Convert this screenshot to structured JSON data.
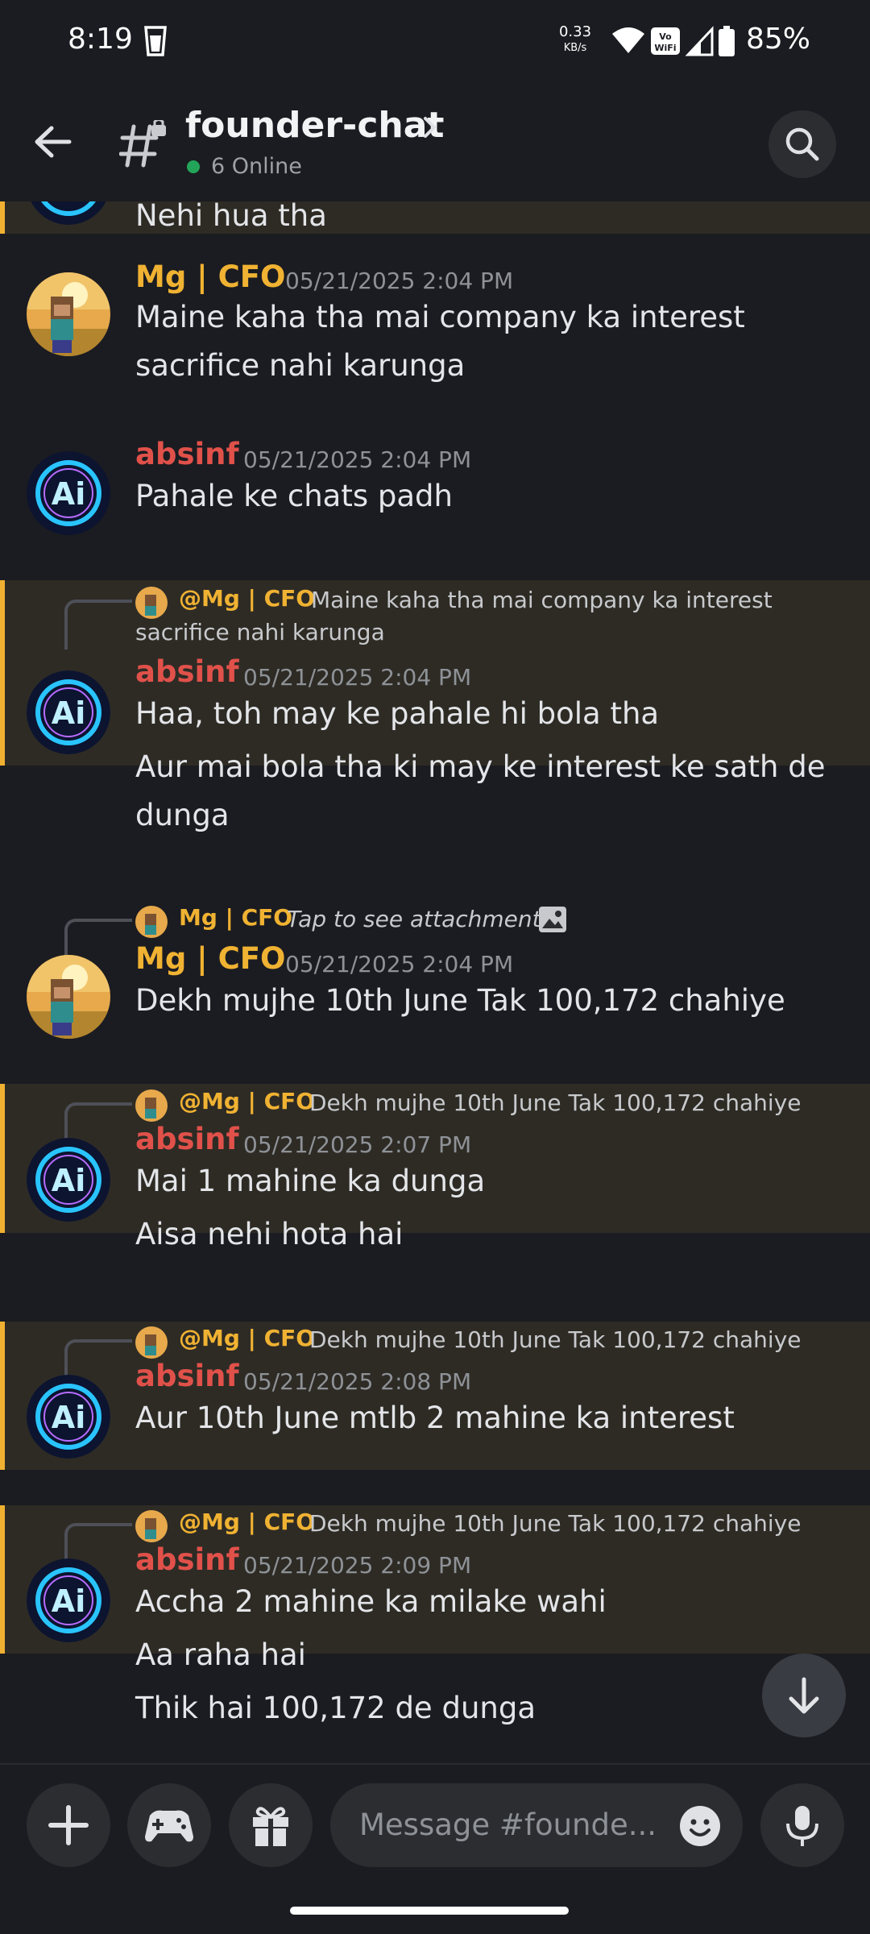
{
  "status_bar": {
    "time": "8:19",
    "net_speed": "0.33",
    "net_unit": "KB/s",
    "battery": "85%",
    "icons": [
      "trash-icon",
      "wifi-icon",
      "vowifi-icon",
      "signal-icon",
      "battery-icon"
    ]
  },
  "header": {
    "channel_name": "founder-chat",
    "online": "6 Online",
    "online_color": "#23a559"
  },
  "colors": {
    "cfo_name": "#f0b232",
    "absinf_name": "#e0514a",
    "highlight_bg": "#2e2b25",
    "highlight_bar": "#f0b132"
  },
  "messages": {
    "m0_text": "Nehi hua tha",
    "m1": {
      "author": "Mg | CFO",
      "time": "05/21/2025 2:04 PM",
      "line1": "Maine kaha tha mai company ka interest",
      "line2": "sacrifice nahi karunga"
    },
    "m2": {
      "author": "absinf",
      "time": "05/21/2025 2:04 PM",
      "text": "Pahale ke chats padh"
    },
    "m3": {
      "reply_name": "@Mg | CFO",
      "reply_line1": "Maine kaha tha mai company ka interest",
      "reply_line2": "sacrifice nahi karunga",
      "author": "absinf",
      "time": "05/21/2025 2:04 PM",
      "text": "Haa, toh may ke pahale hi bola tha"
    },
    "m3b": {
      "line1": "Aur mai bola tha ki may ke interest ke sath de",
      "line2": "dunga"
    },
    "m4": {
      "reply_name": "Mg | CFO",
      "reply_text": "Tap to see attachment",
      "author": "Mg | CFO",
      "time": "05/21/2025 2:04 PM",
      "text": "Dekh mujhe 10th June Tak 100,172 chahiye"
    },
    "m5": {
      "reply_name": "@Mg | CFO",
      "reply_text": "Dekh mujhe 10th June Tak 100,172 chahiye",
      "author": "absinf",
      "time": "05/21/2025 2:07 PM",
      "text": "Mai 1 mahine ka dunga"
    },
    "m5b": "Aisa nehi hota hai",
    "m6": {
      "reply_name": "@Mg | CFO",
      "reply_text": "Dekh mujhe 10th June Tak 100,172 chahiye",
      "author": "absinf",
      "time": "05/21/2025 2:08 PM",
      "text": "Aur 10th June mtlb 2 mahine ka interest"
    },
    "m7": {
      "reply_name": "@Mg | CFO",
      "reply_text": "Dekh mujhe 10th June Tak 100,172 chahiye",
      "author": "absinf",
      "time": "05/21/2025 2:09 PM",
      "text": "Accha 2 mahine ka milake wahi"
    },
    "m7b": "Aa raha hai",
    "m7c": "Thik hai 100,172 de dunga"
  },
  "composer": {
    "placeholder": "Message #founde..."
  }
}
